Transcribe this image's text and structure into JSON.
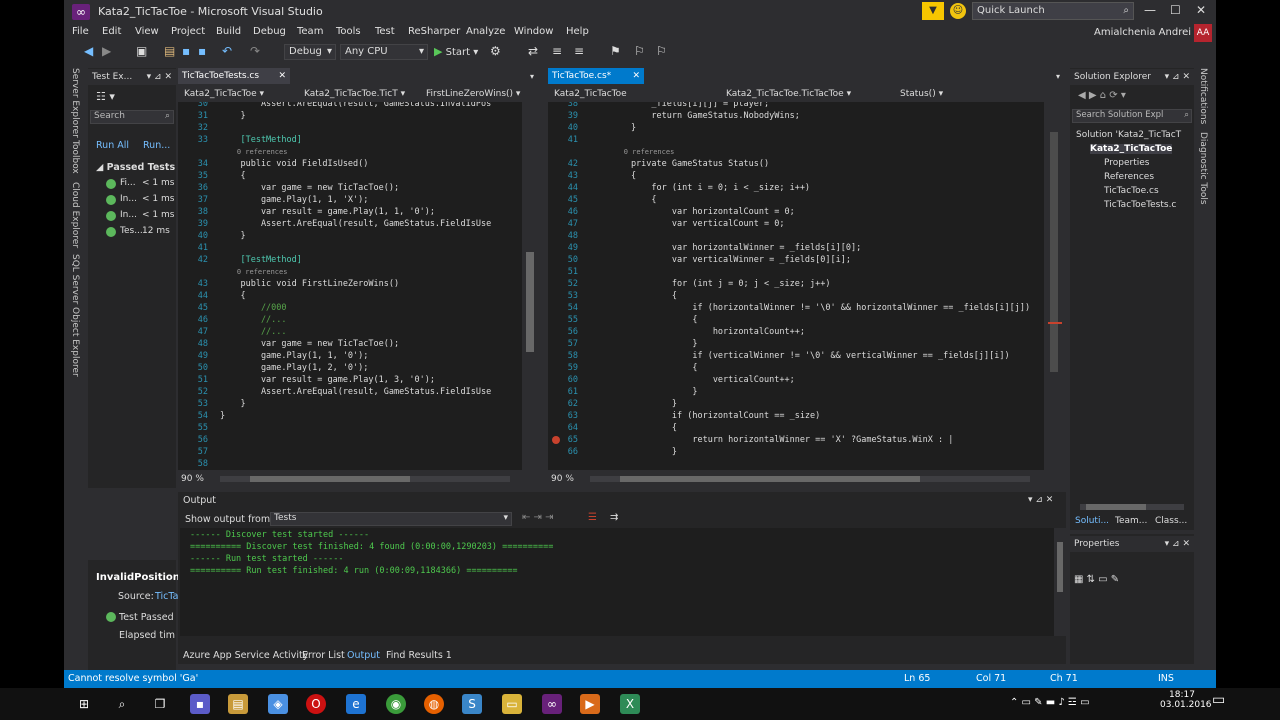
{
  "window": {
    "title": "Kata2_TicTacToe - Microsoft Visual Studio",
    "quick_launch_placeholder": "Quick Launch",
    "user": "Amialchenia Andrei",
    "avatar": "AA"
  },
  "menu": [
    "File",
    "Edit",
    "View",
    "Project",
    "Build",
    "Debug",
    "Team",
    "Tools",
    "Test",
    "ReSharper",
    "Analyze",
    "Window",
    "Help"
  ],
  "toolbar": {
    "config": "Debug",
    "platform": "Any CPU",
    "start": "Start"
  },
  "side_tabs_left": [
    "Server Explorer",
    "Toolbox",
    "Cloud Explorer",
    "SQL Server Object Explorer"
  ],
  "side_tabs_right": [
    "Notifications",
    "Diagnostic Tools"
  ],
  "test_explorer": {
    "title": "Test Ex...",
    "search": "Search",
    "run_all": "Run All",
    "run": "Run...",
    "group": "Passed Tests (4",
    "tests": [
      {
        "name": "Fi...",
        "time": "< 1 ms"
      },
      {
        "name": "In...",
        "time": "< 1 ms"
      },
      {
        "name": "In...",
        "time": "< 1 ms"
      },
      {
        "name": "Tes...",
        "time": "12 ms"
      }
    ]
  },
  "test_details": {
    "name": "InvalidPosition",
    "source_label": "Source:",
    "source": "TicTa",
    "status": "Test Passed",
    "elapsed": "Elapsed tim"
  },
  "left_editor": {
    "tab": "TicTacToeTests.cs",
    "nav": [
      "Kata2_TicTacToe",
      "Kata2_TicTacToe.TicT",
      "FirstLineZeroWins()"
    ],
    "zoom": "90 %",
    "lines": [
      {
        "n": "30",
        "t": "        Assert.AreEqual(result, GameStatus.InvalidPos",
        "c": ""
      },
      {
        "n": "31",
        "t": "    }",
        "c": ""
      },
      {
        "n": "32",
        "t": "",
        "c": ""
      },
      {
        "n": "33",
        "t": "    [TestMethod]",
        "c": "at"
      },
      {
        "n": "",
        "t": "    0 references",
        "c": "ref"
      },
      {
        "n": "34",
        "t": "    public void FieldIsUsed()",
        "c": ""
      },
      {
        "n": "35",
        "t": "    {",
        "c": ""
      },
      {
        "n": "36",
        "t": "        var game = new TicTacToe();",
        "c": ""
      },
      {
        "n": "37",
        "t": "        game.Play(1, 1, 'X');",
        "c": ""
      },
      {
        "n": "38",
        "t": "        var result = game.Play(1, 1, '0');",
        "c": ""
      },
      {
        "n": "39",
        "t": "        Assert.AreEqual(result, GameStatus.FieldIsUse",
        "c": ""
      },
      {
        "n": "40",
        "t": "    }",
        "c": ""
      },
      {
        "n": "41",
        "t": "",
        "c": ""
      },
      {
        "n": "42",
        "t": "    [TestMethod]",
        "c": "at"
      },
      {
        "n": "",
        "t": "    0 references",
        "c": "ref"
      },
      {
        "n": "43",
        "t": "    public void FirstLineZeroWins()",
        "c": ""
      },
      {
        "n": "44",
        "t": "    {",
        "c": ""
      },
      {
        "n": "45",
        "t": "        //000",
        "c": "cm"
      },
      {
        "n": "46",
        "t": "        //...",
        "c": "cm"
      },
      {
        "n": "47",
        "t": "        //...",
        "c": "cm"
      },
      {
        "n": "48",
        "t": "        var game = new TicTacToe();",
        "c": ""
      },
      {
        "n": "49",
        "t": "        game.Play(1, 1, '0');",
        "c": ""
      },
      {
        "n": "50",
        "t": "        game.Play(1, 2, '0');",
        "c": ""
      },
      {
        "n": "51",
        "t": "        var result = game.Play(1, 3, '0');",
        "c": ""
      },
      {
        "n": "52",
        "t": "        Assert.AreEqual(result, GameStatus.FieldIsUse",
        "c": ""
      },
      {
        "n": "53",
        "t": "    }",
        "c": ""
      },
      {
        "n": "54",
        "t": "}",
        "c": ""
      },
      {
        "n": "55",
        "t": "",
        "c": ""
      },
      {
        "n": "56",
        "t": "",
        "c": ""
      },
      {
        "n": "57",
        "t": "",
        "c": ""
      },
      {
        "n": "58",
        "t": "",
        "c": ""
      }
    ]
  },
  "right_editor": {
    "tab": "TicTacToe.cs*",
    "nav": [
      "Kata2_TicTacToe",
      "Kata2_TicTacToe.TicTacToe",
      "Status()"
    ],
    "zoom": "90 %",
    "lines": [
      {
        "n": "38",
        "t": "            _fields[i][j] = player;",
        "c": ""
      },
      {
        "n": "39",
        "t": "            return GameStatus.NobodyWins;",
        "c": ""
      },
      {
        "n": "40",
        "t": "        }",
        "c": ""
      },
      {
        "n": "41",
        "t": "",
        "c": ""
      },
      {
        "n": "",
        "t": "        0 references",
        "c": "ref"
      },
      {
        "n": "42",
        "t": "        private GameStatus Status()",
        "c": ""
      },
      {
        "n": "43",
        "t": "        {",
        "c": ""
      },
      {
        "n": "44",
        "t": "            for (int i = 0; i < _size; i++)",
        "c": ""
      },
      {
        "n": "45",
        "t": "            {",
        "c": ""
      },
      {
        "n": "46",
        "t": "                var horizontalCount = 0;",
        "c": ""
      },
      {
        "n": "47",
        "t": "                var verticalCount = 0;",
        "c": ""
      },
      {
        "n": "48",
        "t": "",
        "c": ""
      },
      {
        "n": "49",
        "t": "                var horizontalWinner = _fields[i][0];",
        "c": ""
      },
      {
        "n": "50",
        "t": "                var verticalWinner = _fields[0][i];",
        "c": ""
      },
      {
        "n": "51",
        "t": "",
        "c": ""
      },
      {
        "n": "52",
        "t": "                for (int j = 0; j < _size; j++)",
        "c": ""
      },
      {
        "n": "53",
        "t": "                {",
        "c": ""
      },
      {
        "n": "54",
        "t": "                    if (horizontalWinner != '\\0' && horizontalWinner == _fields[i][j])",
        "c": ""
      },
      {
        "n": "55",
        "t": "                    {",
        "c": ""
      },
      {
        "n": "56",
        "t": "                        horizontalCount++;",
        "c": ""
      },
      {
        "n": "57",
        "t": "                    }",
        "c": ""
      },
      {
        "n": "58",
        "t": "                    if (verticalWinner != '\\0' && verticalWinner == _fields[j][i])",
        "c": ""
      },
      {
        "n": "59",
        "t": "                    {",
        "c": ""
      },
      {
        "n": "60",
        "t": "                        verticalCount++;",
        "c": ""
      },
      {
        "n": "61",
        "t": "                    }",
        "c": ""
      },
      {
        "n": "62",
        "t": "                }",
        "c": ""
      },
      {
        "n": "63",
        "t": "                if (horizontalCount == _size)",
        "c": ""
      },
      {
        "n": "64",
        "t": "                {",
        "c": ""
      },
      {
        "n": "65",
        "t": "                    return horizontalWinner == 'X' ?GameStatus.WinX : |",
        "c": ""
      },
      {
        "n": "66",
        "t": "                }",
        "c": ""
      }
    ]
  },
  "output": {
    "title": "Output",
    "show_from_label": "Show output from:",
    "source": "Tests",
    "lines": [
      "------ Discover test started ------",
      "========== Discover test finished: 4 found (0:00:00,1290203) ==========",
      "------ Run test started ------",
      "========== Run test finished: 4 run (0:00:09,1184366) =========="
    ]
  },
  "bottom_tabs": [
    "Azure App Service Activity",
    "Error List",
    "Output",
    "Find Results 1"
  ],
  "solution": {
    "title": "Solution Explorer",
    "search": "Search Solution Expl",
    "items": [
      {
        "label": "Solution 'Kata2_TicTacT",
        "indent": 0
      },
      {
        "label": "Kata2_TicTacToe",
        "indent": 1
      },
      {
        "label": "Properties",
        "indent": 2
      },
      {
        "label": "References",
        "indent": 2
      },
      {
        "label": "TicTacToe.cs",
        "indent": 2
      },
      {
        "label": "TicTacToeTests.c",
        "indent": 2
      }
    ],
    "tabs": [
      "Soluti...",
      "Team...",
      "Class..."
    ]
  },
  "properties": {
    "title": "Properties"
  },
  "status": {
    "message": "Cannot resolve symbol 'Ga'",
    "ln": "Ln 65",
    "col": "Col 71",
    "ch": "Ch 71",
    "mode": "INS"
  },
  "clock": {
    "time": "18:17",
    "date": "03.01.2016"
  }
}
